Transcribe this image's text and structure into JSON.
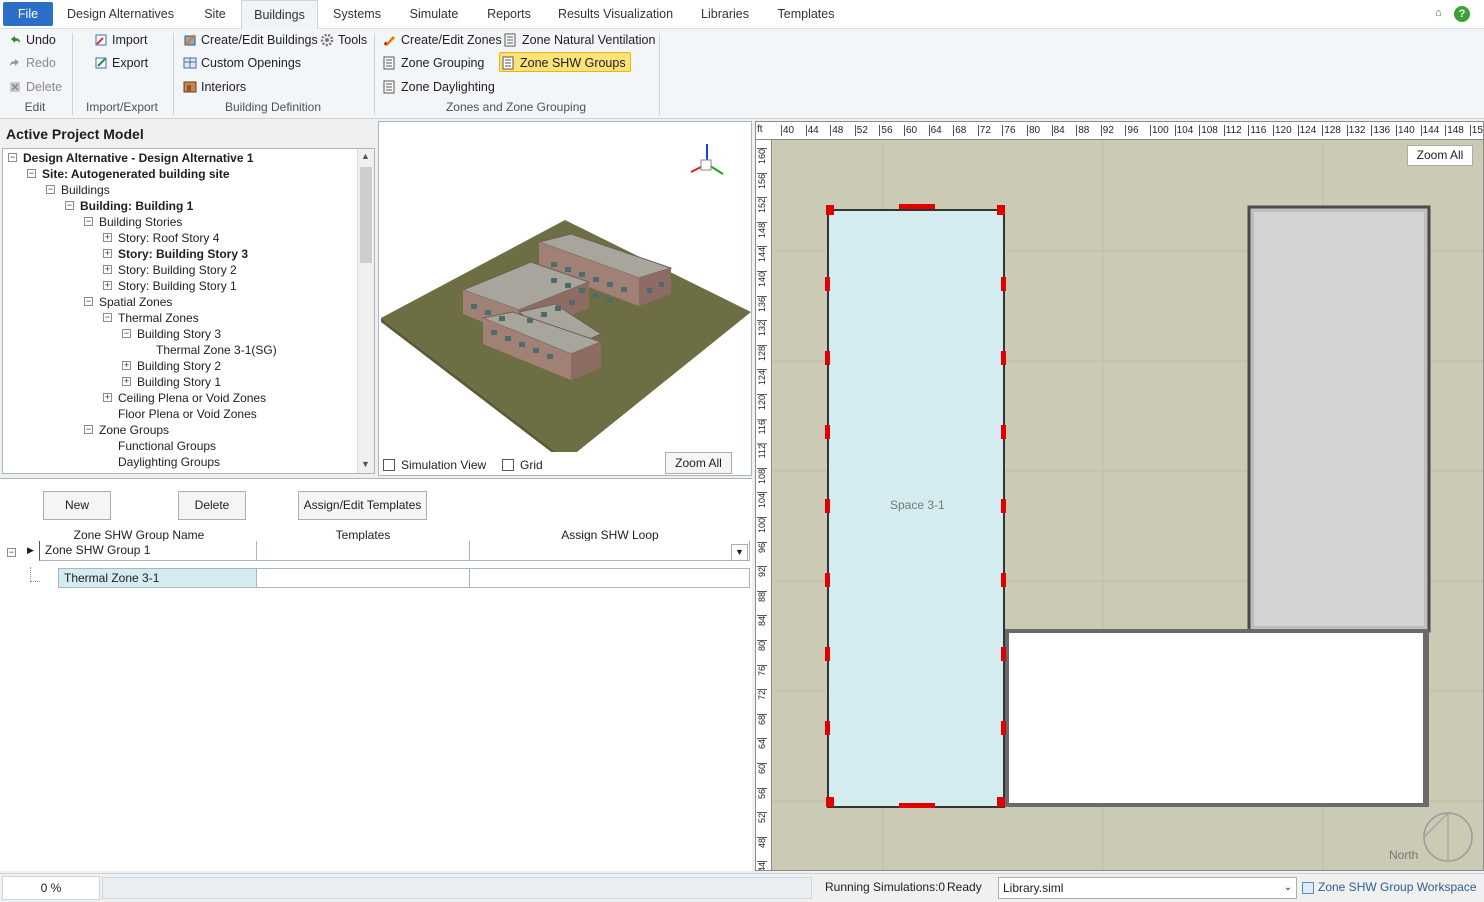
{
  "menu": {
    "file": "File",
    "tabs": [
      "Design Alternatives",
      "Site",
      "Buildings",
      "Systems",
      "Simulate",
      "Reports",
      "Results Visualization",
      "Libraries",
      "Templates"
    ],
    "active_tab": "Buildings"
  },
  "ribbon": {
    "edit": {
      "undo": "Undo",
      "redo": "Redo",
      "delete": "Delete",
      "label": "Edit"
    },
    "import_export": {
      "import": "Import",
      "export": "Export",
      "label": "Import/Export"
    },
    "building_definition": {
      "create_edit": "Create/Edit Buildings",
      "tools": "Tools",
      "custom_openings": "Custom Openings",
      "interiors": "Interiors",
      "label": "Building Definition"
    },
    "zones": {
      "create_edit_zones": "Create/Edit Zones",
      "zone_natural_ventilation": "Zone Natural Ventilation",
      "zone_grouping": "Zone Grouping",
      "zone_shw_groups": "Zone SHW Groups",
      "zone_daylighting": "Zone Daylighting",
      "label": "Zones and Zone Grouping"
    }
  },
  "project": {
    "title": "Active Project Model",
    "tree": [
      "Design Alternative - Design Alternative 1",
      "Site: Autogenerated building site",
      "Buildings",
      "Building: Building  1",
      "Building Stories",
      "Story: Roof Story 4",
      "Story: Building Story 3",
      "Story: Building Story 2",
      "Story: Building Story 1",
      "Spatial Zones",
      "Thermal Zones",
      "Building Story 3",
      "Thermal Zone 3-1(SG)",
      "Building Story 2",
      "Building Story 1",
      "Ceiling Plena or Void Zones",
      "Floor Plena or Void Zones",
      "Zone Groups",
      "Functional Groups",
      "Daylighting Groups"
    ]
  },
  "view3d": {
    "simulation_view": "Simulation View",
    "grid": "Grid",
    "zoom_all": "Zoom All"
  },
  "grid": {
    "new": "New",
    "delete": "Delete",
    "assign_edit": "Assign/Edit Templates",
    "headers": [
      "Zone SHW Group Name",
      "Templates",
      "Assign SHW Loop"
    ],
    "group_row": "Zone SHW Group 1",
    "child_row": "Thermal Zone 3-1"
  },
  "plan": {
    "zoom_all": "Zoom All",
    "space_label": "Space 3-1",
    "north": "North",
    "ruler_unit": "ft",
    "ruler_top": [
      "40",
      "44",
      "48",
      "52",
      "56",
      "60",
      "64",
      "68",
      "72",
      "76",
      "80",
      "84",
      "88",
      "92",
      "96",
      "100",
      "104",
      "108",
      "112",
      "116",
      "120",
      "124",
      "128",
      "132",
      "136",
      "140",
      "144",
      "148",
      "152",
      "15"
    ],
    "ruler_left": [
      "160",
      "156",
      "152",
      "148",
      "144",
      "140",
      "136",
      "132",
      "128",
      "124",
      "120",
      "116",
      "112",
      "108",
      "104",
      "100",
      "96",
      "92",
      "88",
      "84",
      "80",
      "76",
      "72",
      "68",
      "64",
      "60",
      "56",
      "52",
      "48",
      "44"
    ]
  },
  "status": {
    "progress": "0 %",
    "running": "Running Simulations:0",
    "ready": "Ready",
    "library": "Library.siml",
    "workspace": "Zone SHW Group Workspace"
  },
  "colors": {
    "accent": "#2b6fc7",
    "selected": "#fbe27a",
    "zone_fill": "#d4ecef",
    "plan_bg": "#cbcab4",
    "handle": "#e00000"
  }
}
